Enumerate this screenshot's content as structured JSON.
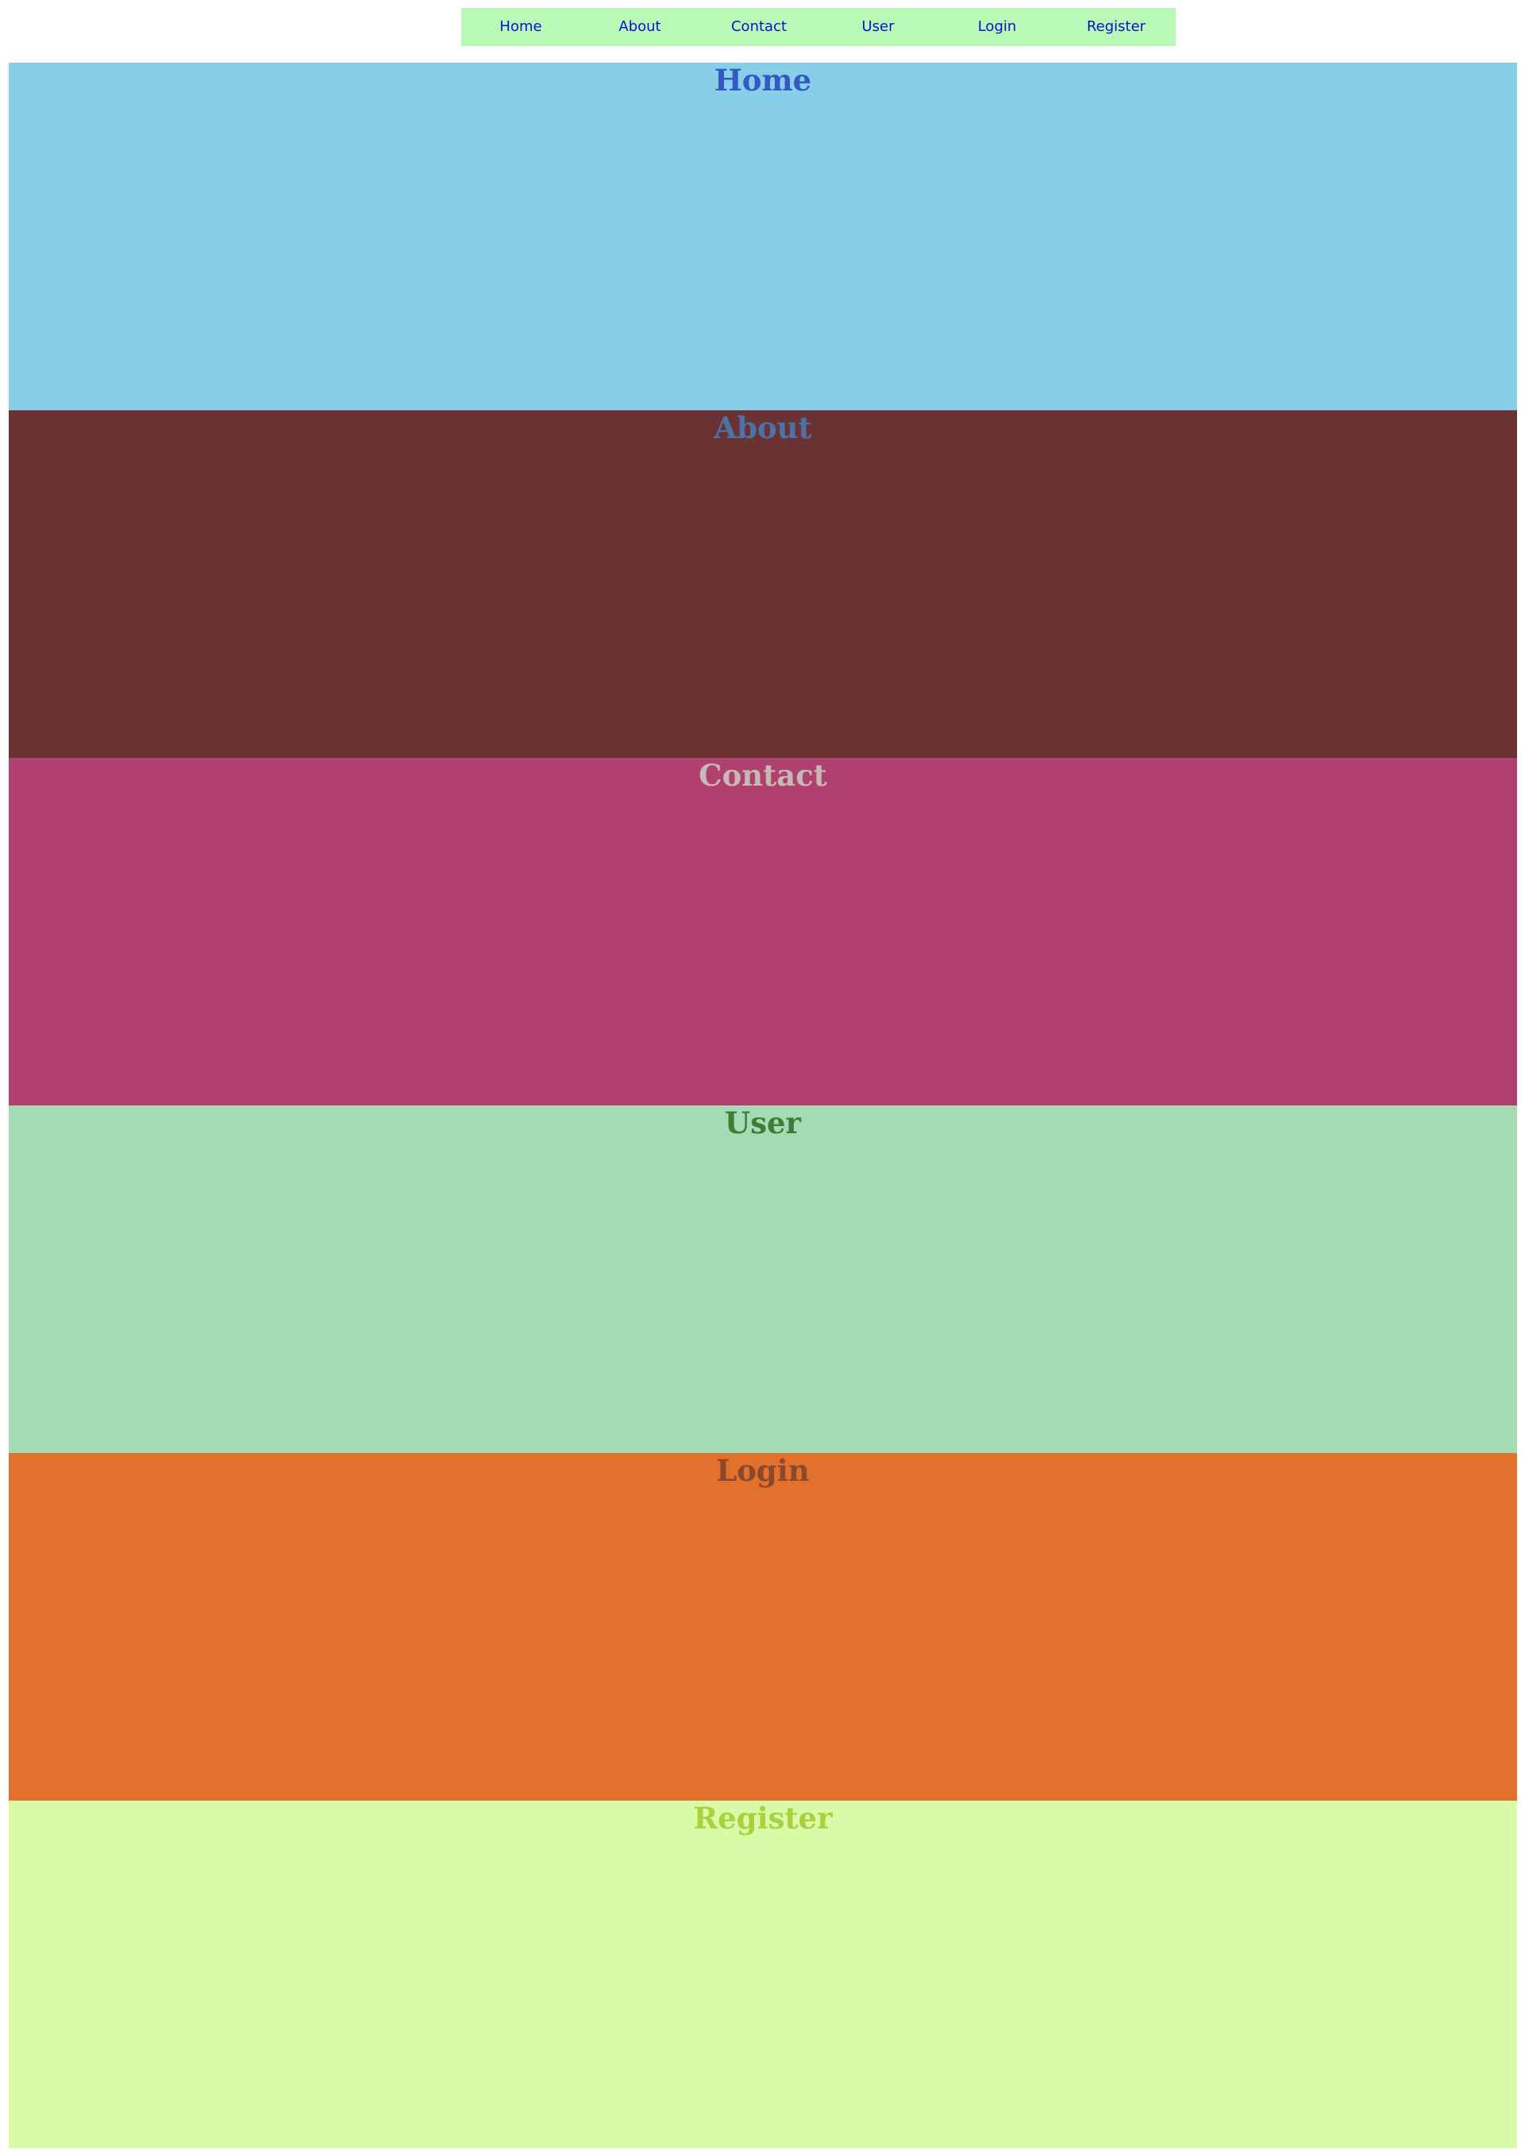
{
  "nav": {
    "items": [
      {
        "label": "Home"
      },
      {
        "label": "About"
      },
      {
        "label": "Contact"
      },
      {
        "label": "User"
      },
      {
        "label": "Login"
      },
      {
        "label": "Register"
      }
    ],
    "background": "#b7f9b5",
    "link_color": "#0d0fd6"
  },
  "sections": [
    {
      "title": "Home",
      "background": "#87cee8",
      "title_color": "#3658c2"
    },
    {
      "title": "About",
      "background": "#6a3233",
      "title_color": "#4b73a8"
    },
    {
      "title": "Contact",
      "background": "#b0406d",
      "title_color": "#c7b8b8"
    },
    {
      "title": "User",
      "background": "#a4dbb5",
      "title_color": "#3d7d36"
    },
    {
      "title": "Login",
      "background": "#e1712c",
      "title_color": "#8a4a2a"
    },
    {
      "title": "Register",
      "background": "#d9fba7",
      "title_color": "#aad040"
    }
  ]
}
